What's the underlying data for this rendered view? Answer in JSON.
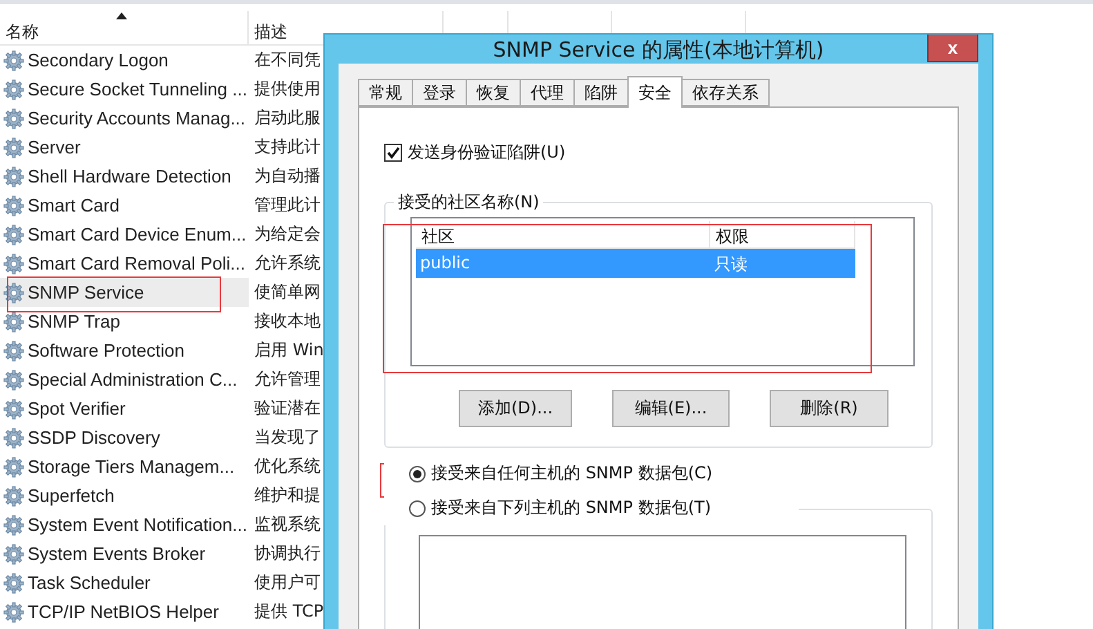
{
  "services": {
    "columns": [
      {
        "label": "名称",
        "sorted": true
      },
      {
        "label": "描述",
        "sorted": false
      }
    ],
    "rows": [
      {
        "name": "Secondary Logon",
        "description": "在不同凭",
        "selected": false
      },
      {
        "name": "Secure Socket Tunneling ...",
        "description": "提供使用",
        "selected": false
      },
      {
        "name": "Security Accounts Manag...",
        "description": "启动此服",
        "selected": false
      },
      {
        "name": "Server",
        "description": "支持此计",
        "selected": false
      },
      {
        "name": "Shell Hardware Detection",
        "description": "为自动播",
        "selected": false
      },
      {
        "name": "Smart Card",
        "description": "管理此计",
        "selected": false
      },
      {
        "name": "Smart Card Device Enum...",
        "description": "为给定会",
        "selected": false
      },
      {
        "name": "Smart Card Removal Poli...",
        "description": "允许系统",
        "selected": false
      },
      {
        "name": "SNMP Service",
        "description": "使简单网",
        "selected": true
      },
      {
        "name": "SNMP Trap",
        "description": "接收本地",
        "selected": false
      },
      {
        "name": "Software Protection",
        "description": "启用 Win",
        "selected": false
      },
      {
        "name": "Special Administration C...",
        "description": "允许管理",
        "selected": false
      },
      {
        "name": "Spot Verifier",
        "description": "验证潜在",
        "selected": false
      },
      {
        "name": "SSDP Discovery",
        "description": "当发现了",
        "selected": false
      },
      {
        "name": "Storage Tiers Managem...",
        "description": "优化系统",
        "selected": false
      },
      {
        "name": "Superfetch",
        "description": "维护和提",
        "selected": false
      },
      {
        "name": "System Event Notification...",
        "description": "监视系统",
        "selected": false
      },
      {
        "name": "System Events Broker",
        "description": "协调执行",
        "selected": false
      },
      {
        "name": "Task Scheduler",
        "description": "使用户可",
        "selected": false
      },
      {
        "name": "TCP/IP NetBIOS Helper",
        "description": "提供 TCP",
        "selected": false
      }
    ]
  },
  "dialog": {
    "title": "SNMP Service 的属性(本地计算机)",
    "close": "x",
    "tabs": [
      {
        "label": "常规",
        "selected": false
      },
      {
        "label": "登录",
        "selected": false
      },
      {
        "label": "恢复",
        "selected": false
      },
      {
        "label": "代理",
        "selected": false
      },
      {
        "label": "陷阱",
        "selected": false
      },
      {
        "label": "安全",
        "selected": true
      },
      {
        "label": "依存关系",
        "selected": false
      }
    ],
    "send_auth_trap": {
      "label": "发送身份验证陷阱(U)",
      "checked": true
    },
    "communities": {
      "title": "接受的社区名称(N)",
      "columns": [
        "社区",
        "权限"
      ],
      "rows": [
        {
          "community": "public",
          "rights": "只读",
          "selected": true
        }
      ]
    },
    "buttons": [
      "添加(D)...",
      "编辑(E)...",
      "删除(R)"
    ],
    "packet_sources": [
      {
        "label": "接受来自任何主机的 SNMP 数据包(C)",
        "selected": true
      },
      {
        "label": "接受来自下列主机的 SNMP 数据包(T)",
        "selected": false
      }
    ]
  }
}
